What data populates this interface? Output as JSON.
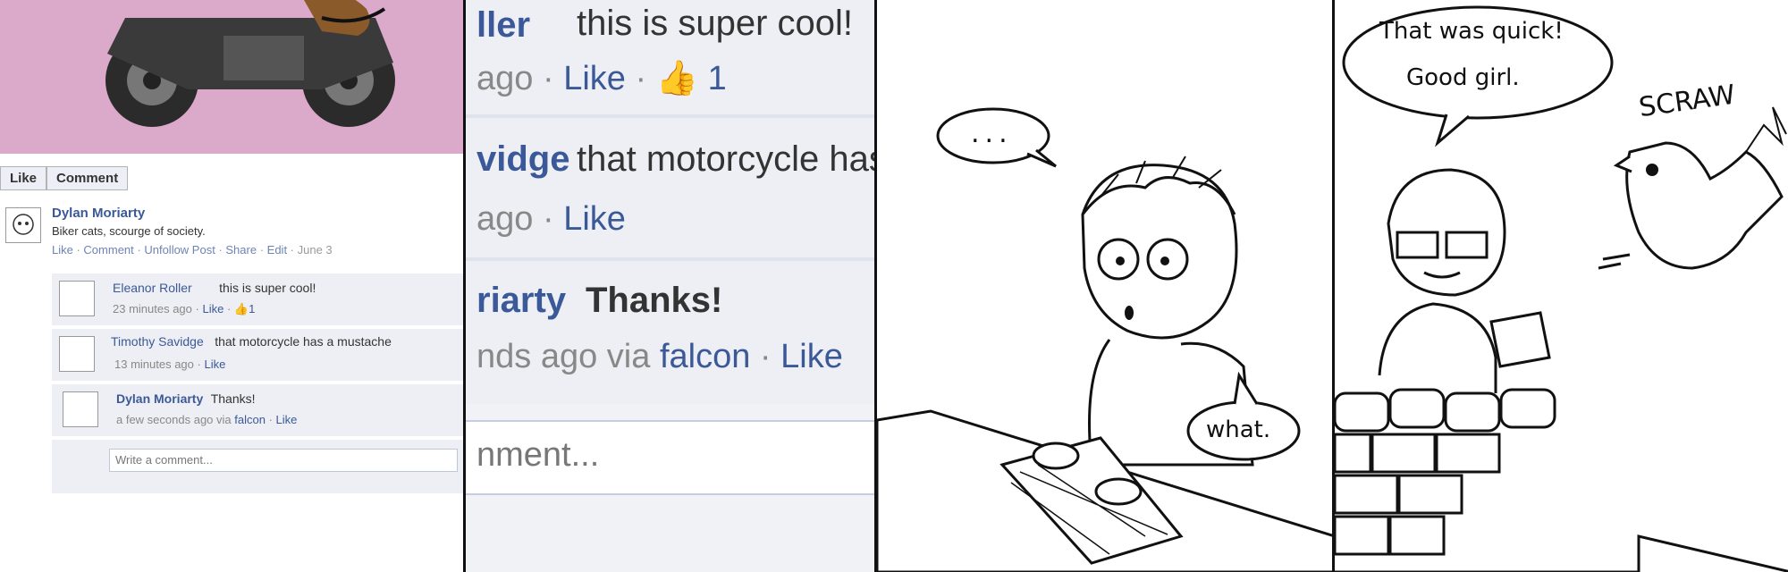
{
  "post": {
    "like_button": "Like",
    "comment_button": "Comment",
    "author": "Dylan Moriarty",
    "text": "Biker cats, scourge of society.",
    "actions": [
      "Like",
      "Comment",
      "Unfollow Post",
      "Share",
      "Edit",
      "June 3"
    ],
    "separator": " · "
  },
  "comments": [
    {
      "name": "Eleanor Roller",
      "text": "this is super cool!",
      "time": "23 minutes ago",
      "like": "Like",
      "likes_count": "1"
    },
    {
      "name": "Timothy Savidge",
      "text": "that motorcycle has a mustache",
      "time": "13 minutes ago",
      "like": "Like"
    },
    {
      "name": "Dylan Moriarty",
      "text": "Thanks!",
      "time": "a few seconds ago via",
      "via": "falcon",
      "like": "Like"
    }
  ],
  "write_placeholder": "Write a comment...",
  "zoom": {
    "r1_name": "ller",
    "r1_text": "this is super cool!",
    "r1_time": "ago",
    "r1_like": "Like",
    "r1_count": "1",
    "r2_name": "vidge",
    "r2_text": "that motorcycle has",
    "r2_time": "ago",
    "r2_like": "Like",
    "r3_name": "riarty",
    "r3_text": "Thanks!",
    "r3_time": "nds ago via",
    "r3_via": "falcon",
    "r3_like": "Like",
    "write": "nment..."
  },
  "comic": {
    "panel3_bubble1": "...",
    "panel3_bubble2": "what.",
    "panel4_bubble_line1": "That was quick!",
    "panel4_bubble_line2": "Good girl.",
    "panel4_sfx": "SCRAW"
  },
  "colors": {
    "fb_blue": "#3b5998",
    "pink": "#dba9c9",
    "comment_bg": "#edeff4"
  }
}
